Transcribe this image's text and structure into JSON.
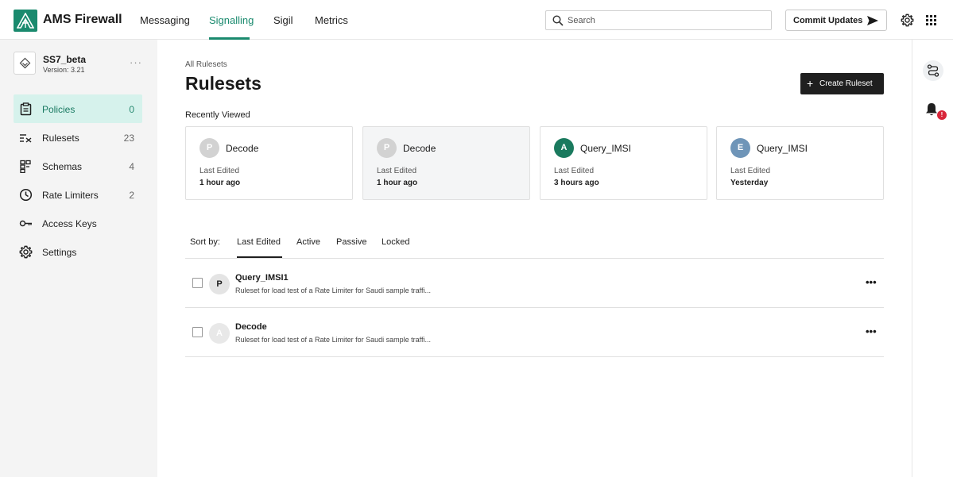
{
  "app": {
    "title": "AMS Firewall",
    "logo_icon": "ams-logo-icon",
    "brand_color": "#1a8a6e"
  },
  "nav": {
    "tabs": [
      {
        "label": "Messaging"
      },
      {
        "label": "Signalling",
        "active": true
      },
      {
        "label": "Sigil"
      },
      {
        "label": "Metrics"
      }
    ]
  },
  "search": {
    "placeholder": "Search",
    "value": ""
  },
  "header": {
    "commit_label": "Commit Updates",
    "icons": [
      "send-icon",
      "gear-icon",
      "apps-grid-icon"
    ]
  },
  "project": {
    "name": "SS7_beta",
    "version": "Version: 3.21",
    "menu": "···"
  },
  "sidebar": {
    "items": [
      {
        "label": "Policies",
        "count": "0",
        "icon": "clipboard-icon",
        "active": true
      },
      {
        "label": "Rulesets",
        "count": "23",
        "icon": "list-check-icon"
      },
      {
        "label": "Schemas",
        "count": "4",
        "icon": "schema-icon"
      },
      {
        "label": "Rate Limiters",
        "count": "2",
        "icon": "clock-icon"
      },
      {
        "label": "Access Keys",
        "count": "",
        "icon": "key-icon"
      },
      {
        "label": "Settings",
        "count": "",
        "icon": "gear-icon"
      }
    ]
  },
  "right_rail": {
    "icons": [
      "route-icon",
      "bell-icon"
    ],
    "badge": "!"
  },
  "main": {
    "breadcrumb": "All Rulesets",
    "title": "Rulesets",
    "create_label": "Create Ruleset",
    "create_plus": "+",
    "recent_heading": "Recently Viewed",
    "recent": [
      {
        "initial": "P",
        "name": "Decode",
        "edited_label": "Last Edited",
        "edited": "1 hour ago",
        "avatar_color": "#d2d2d2"
      },
      {
        "initial": "P",
        "name": "Decode",
        "edited_label": "Last Edited",
        "edited": "1 hour ago",
        "avatar_color": "#d2d2d2"
      },
      {
        "initial": "A",
        "name": "Query_IMSI",
        "edited_label": "Last Edited",
        "edited": "3 hours ago",
        "avatar_color": "#1a7a5e"
      },
      {
        "initial": "E",
        "name": "Query_IMSI",
        "edited_label": "Last Edited",
        "edited": "Yesterday",
        "avatar_color": "#6f95b8"
      }
    ],
    "sort": {
      "label": "Sort by:",
      "tabs": [
        "Last Edited",
        "Active",
        "Passive",
        "Locked"
      ],
      "active": "Last Edited"
    },
    "rows": [
      {
        "initial": "P",
        "name": "Query_IMSI1",
        "desc": "Ruleset for load test of a Rate Limiter for Saudi sample traffi...",
        "menu": "•••"
      },
      {
        "initial": "A",
        "name": "Decode",
        "desc": "Ruleset for load test of a Rate Limiter for Saudi sample traffi...",
        "menu": "•••"
      }
    ]
  }
}
